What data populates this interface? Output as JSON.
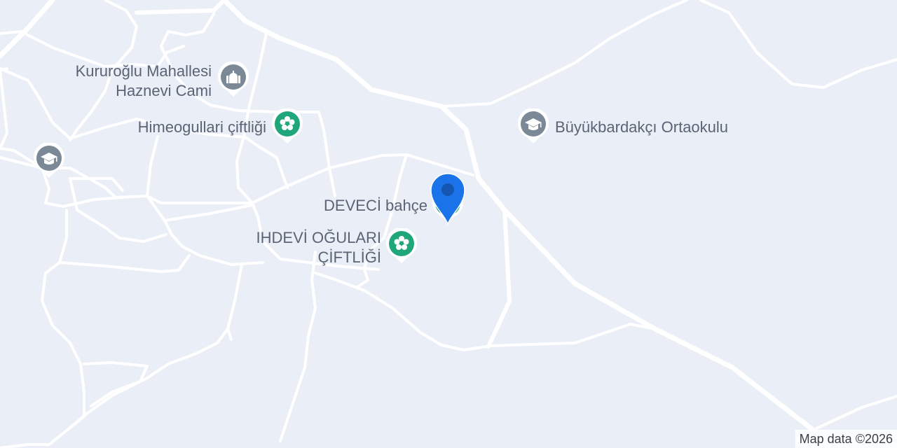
{
  "map": {
    "background_color": "#eaeef6",
    "road_color": "#ffffff",
    "attribution": "Map data ©2026"
  },
  "pois": [
    {
      "id": "mosque",
      "label": "Kururoğlu Mahallesi\nHaznevi Cami",
      "icon": "mosque-icon",
      "color": "#7b8896"
    },
    {
      "id": "himeogullari",
      "label": "Himeogullari çiftliği",
      "icon": "flower-icon",
      "color": "#1fa67a"
    },
    {
      "id": "school-left",
      "label": "",
      "icon": "school-icon",
      "color": "#7b8896"
    },
    {
      "id": "ortaokulu",
      "label": "Büyükbardakçı Ortaokulu",
      "icon": "school-icon",
      "color": "#7b8896"
    },
    {
      "id": "deveci",
      "label": "DEVECİ bahçe",
      "icon": "flower-icon",
      "color": "#1fa67a"
    },
    {
      "id": "ihdevi",
      "label": "IHDEVİ OĞULARI\nÇİFTLİĞİ",
      "icon": "flower-icon",
      "color": "#1fa67a"
    }
  ],
  "selected_pin": {
    "icon": "location-pin-icon",
    "color": "#1a73e8"
  }
}
